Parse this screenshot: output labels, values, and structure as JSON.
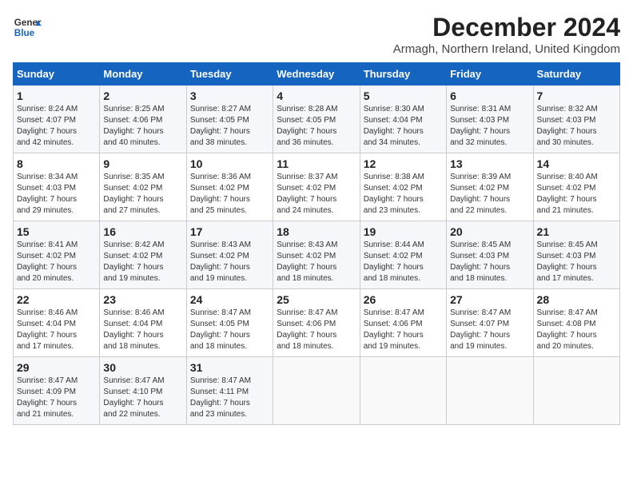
{
  "header": {
    "logo_line1": "General",
    "logo_line2": "Blue",
    "month_title": "December 2024",
    "subtitle": "Armagh, Northern Ireland, United Kingdom"
  },
  "weekdays": [
    "Sunday",
    "Monday",
    "Tuesday",
    "Wednesday",
    "Thursday",
    "Friday",
    "Saturday"
  ],
  "weeks": [
    [
      {
        "day": "1",
        "info": "Sunrise: 8:24 AM\nSunset: 4:07 PM\nDaylight: 7 hours\nand 42 minutes."
      },
      {
        "day": "2",
        "info": "Sunrise: 8:25 AM\nSunset: 4:06 PM\nDaylight: 7 hours\nand 40 minutes."
      },
      {
        "day": "3",
        "info": "Sunrise: 8:27 AM\nSunset: 4:05 PM\nDaylight: 7 hours\nand 38 minutes."
      },
      {
        "day": "4",
        "info": "Sunrise: 8:28 AM\nSunset: 4:05 PM\nDaylight: 7 hours\nand 36 minutes."
      },
      {
        "day": "5",
        "info": "Sunrise: 8:30 AM\nSunset: 4:04 PM\nDaylight: 7 hours\nand 34 minutes."
      },
      {
        "day": "6",
        "info": "Sunrise: 8:31 AM\nSunset: 4:03 PM\nDaylight: 7 hours\nand 32 minutes."
      },
      {
        "day": "7",
        "info": "Sunrise: 8:32 AM\nSunset: 4:03 PM\nDaylight: 7 hours\nand 30 minutes."
      }
    ],
    [
      {
        "day": "8",
        "info": "Sunrise: 8:34 AM\nSunset: 4:03 PM\nDaylight: 7 hours\nand 29 minutes."
      },
      {
        "day": "9",
        "info": "Sunrise: 8:35 AM\nSunset: 4:02 PM\nDaylight: 7 hours\nand 27 minutes."
      },
      {
        "day": "10",
        "info": "Sunrise: 8:36 AM\nSunset: 4:02 PM\nDaylight: 7 hours\nand 25 minutes."
      },
      {
        "day": "11",
        "info": "Sunrise: 8:37 AM\nSunset: 4:02 PM\nDaylight: 7 hours\nand 24 minutes."
      },
      {
        "day": "12",
        "info": "Sunrise: 8:38 AM\nSunset: 4:02 PM\nDaylight: 7 hours\nand 23 minutes."
      },
      {
        "day": "13",
        "info": "Sunrise: 8:39 AM\nSunset: 4:02 PM\nDaylight: 7 hours\nand 22 minutes."
      },
      {
        "day": "14",
        "info": "Sunrise: 8:40 AM\nSunset: 4:02 PM\nDaylight: 7 hours\nand 21 minutes."
      }
    ],
    [
      {
        "day": "15",
        "info": "Sunrise: 8:41 AM\nSunset: 4:02 PM\nDaylight: 7 hours\nand 20 minutes."
      },
      {
        "day": "16",
        "info": "Sunrise: 8:42 AM\nSunset: 4:02 PM\nDaylight: 7 hours\nand 19 minutes."
      },
      {
        "day": "17",
        "info": "Sunrise: 8:43 AM\nSunset: 4:02 PM\nDaylight: 7 hours\nand 19 minutes."
      },
      {
        "day": "18",
        "info": "Sunrise: 8:43 AM\nSunset: 4:02 PM\nDaylight: 7 hours\nand 18 minutes."
      },
      {
        "day": "19",
        "info": "Sunrise: 8:44 AM\nSunset: 4:02 PM\nDaylight: 7 hours\nand 18 minutes."
      },
      {
        "day": "20",
        "info": "Sunrise: 8:45 AM\nSunset: 4:03 PM\nDaylight: 7 hours\nand 18 minutes."
      },
      {
        "day": "21",
        "info": "Sunrise: 8:45 AM\nSunset: 4:03 PM\nDaylight: 7 hours\nand 17 minutes."
      }
    ],
    [
      {
        "day": "22",
        "info": "Sunrise: 8:46 AM\nSunset: 4:04 PM\nDaylight: 7 hours\nand 17 minutes."
      },
      {
        "day": "23",
        "info": "Sunrise: 8:46 AM\nSunset: 4:04 PM\nDaylight: 7 hours\nand 18 minutes."
      },
      {
        "day": "24",
        "info": "Sunrise: 8:47 AM\nSunset: 4:05 PM\nDaylight: 7 hours\nand 18 minutes."
      },
      {
        "day": "25",
        "info": "Sunrise: 8:47 AM\nSunset: 4:06 PM\nDaylight: 7 hours\nand 18 minutes."
      },
      {
        "day": "26",
        "info": "Sunrise: 8:47 AM\nSunset: 4:06 PM\nDaylight: 7 hours\nand 19 minutes."
      },
      {
        "day": "27",
        "info": "Sunrise: 8:47 AM\nSunset: 4:07 PM\nDaylight: 7 hours\nand 19 minutes."
      },
      {
        "day": "28",
        "info": "Sunrise: 8:47 AM\nSunset: 4:08 PM\nDaylight: 7 hours\nand 20 minutes."
      }
    ],
    [
      {
        "day": "29",
        "info": "Sunrise: 8:47 AM\nSunset: 4:09 PM\nDaylight: 7 hours\nand 21 minutes."
      },
      {
        "day": "30",
        "info": "Sunrise: 8:47 AM\nSunset: 4:10 PM\nDaylight: 7 hours\nand 22 minutes."
      },
      {
        "day": "31",
        "info": "Sunrise: 8:47 AM\nSunset: 4:11 PM\nDaylight: 7 hours\nand 23 minutes."
      },
      {
        "day": "",
        "info": ""
      },
      {
        "day": "",
        "info": ""
      },
      {
        "day": "",
        "info": ""
      },
      {
        "day": "",
        "info": ""
      }
    ]
  ]
}
